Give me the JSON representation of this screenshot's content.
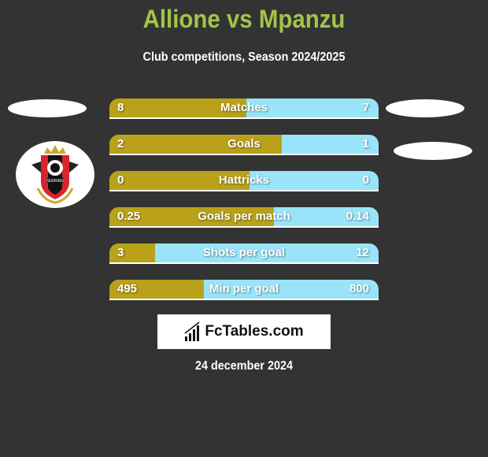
{
  "header": {
    "title": "Allione vs Mpanzu",
    "subtitle": "Club competitions, Season 2024/2025"
  },
  "colors": {
    "background": "#333333",
    "title": "#a2c44a",
    "left_bar": "#b9a11a",
    "right_bar": "#99e4f8"
  },
  "team_left": {
    "logo_icon": "serring-united-crest",
    "logo_text": "SERRING"
  },
  "stats": [
    {
      "label": "Matches",
      "left": "8",
      "right": "7",
      "left_share": 0.51
    },
    {
      "label": "Goals",
      "left": "2",
      "right": "1",
      "left_share": 0.64
    },
    {
      "label": "Hattricks",
      "left": "0",
      "right": "0",
      "left_share": 0.52
    },
    {
      "label": "Goals per match",
      "left": "0.25",
      "right": "0.14",
      "left_share": 0.61
    },
    {
      "label": "Shots per goal",
      "left": "3",
      "right": "12",
      "left_share": 0.17
    },
    {
      "label": "Min per goal",
      "left": "495",
      "right": "800",
      "left_share": 0.35
    }
  ],
  "brand": {
    "icon": "bar-chart-icon",
    "text": "FcTables.com"
  },
  "date": "24 december 2024"
}
